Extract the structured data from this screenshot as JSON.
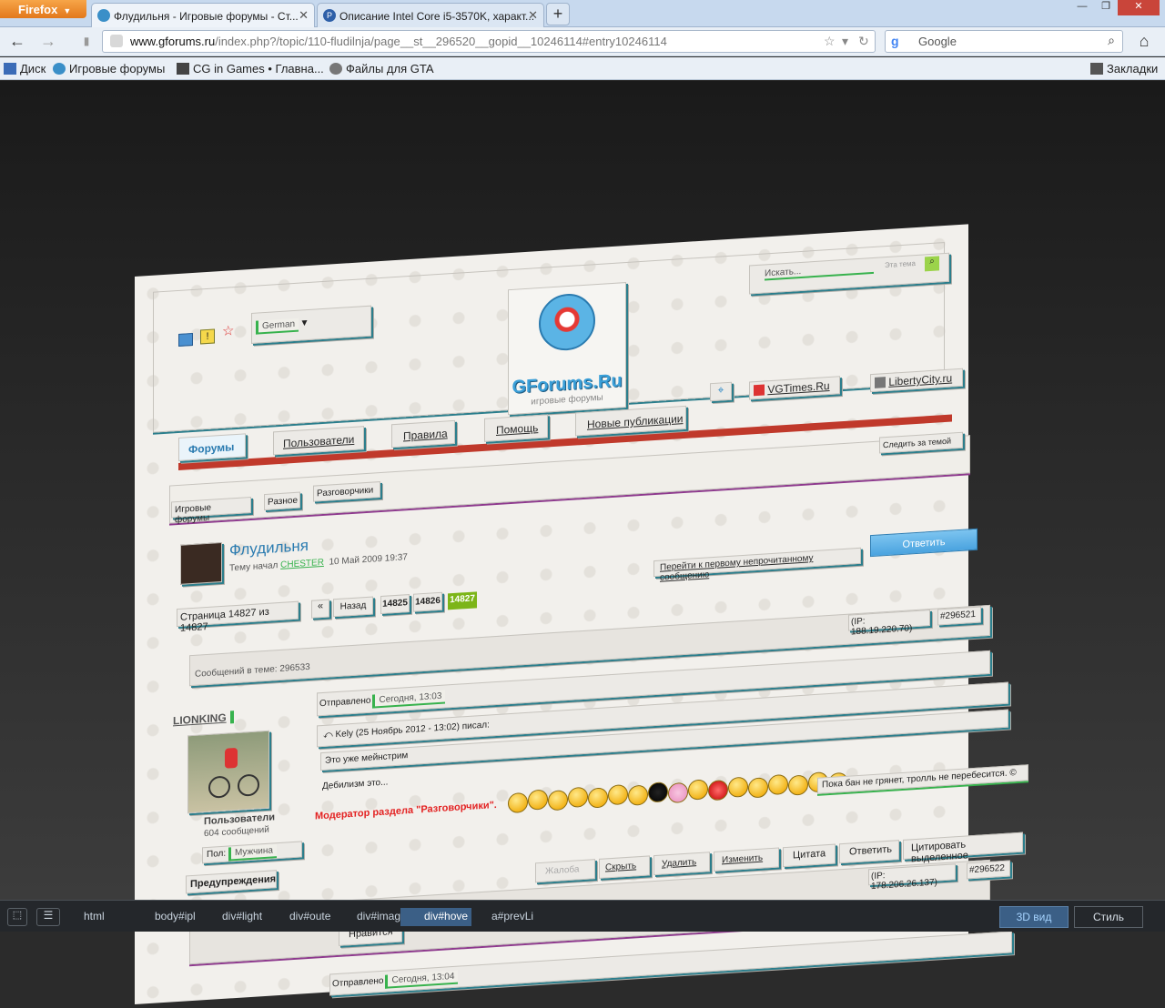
{
  "browser": {
    "menu_button": "Firefox",
    "tabs": [
      {
        "title": "Флудильня - Игровые форумы - Ст...",
        "icon": "forum-favicon"
      },
      {
        "title": "Описание Intel Core i5-3570K, характ...",
        "icon": "p-favicon"
      }
    ],
    "new_tab": "+",
    "url_domain": "www.gforums.ru",
    "url_rest": "/index.php?/topic/110-fludilnja/page__st__296520__gopid__10246114#entry10246114",
    "search_placeholder": "Google",
    "bookmarks": [
      "Диск",
      "Игровые форумы",
      "CG in Games • Главна...",
      "Файлы для GTA"
    ],
    "bookmarks_menu": "Закладки"
  },
  "forum": {
    "language": "German",
    "logo_text": "GForums.Ru",
    "logo_sub": "игровые форумы",
    "search_placeholder": "Искать...",
    "search_scope": "Эта тема",
    "partner_links": [
      "VGTimes.Ru",
      "LibertyCity.ru"
    ],
    "nav": [
      "Форумы",
      "Пользователи",
      "Правила",
      "Помощь",
      "Новые публикации"
    ],
    "breadcrumbs": [
      "Игровые форумы",
      "Разное",
      "Разговорчики"
    ],
    "follow_topic": "Следить за темой",
    "topic_title": "Флудильня",
    "topic_started_prefix": "Тему начал",
    "topic_author": "CHESTER",
    "topic_date": "10 Май 2009 19:37",
    "reply_button": "Ответить",
    "unread_link": "Перейти к первому непрочитанному сообщению",
    "pagination": {
      "page_text": "Страница 14827 из 14827",
      "first": "«",
      "prev": "Назад",
      "pages": [
        "14825",
        "14826",
        "14827"
      ]
    },
    "post_count_text": "Сообщений в теме: 296533",
    "post1": {
      "ip": "(IP: 188.19.220.70)",
      "id": "#296521",
      "author": "LIONKING",
      "sent_label": "Отправлено",
      "sent_time": "Сегодня, 13:03",
      "quote_header": "Kely (25 Ноябрь 2012 - 13:02) писал:",
      "quote_text": "Это уже мейнстрим",
      "body_text": "Дебилизм это...",
      "group": "Пользователи",
      "posts": "604 сообщений",
      "gender_label": "Пол:",
      "gender_value": "Мужчина",
      "warnings": "Предупреждения",
      "moderator_note": "Модератор раздела \"Разговорчики\".",
      "signature": "Пока бан не грянет, тролль не перебесится. ©",
      "actions": [
        "Жалоба",
        "Скрыть",
        "Удалить",
        "Изменить",
        "Цитата",
        "Ответить",
        "Цитировать выделенное"
      ],
      "like_button": "Нравится"
    },
    "post2": {
      "ip": "(IP: 178.206.26.137)",
      "id": "#296522",
      "sent_label": "Отправлено",
      "sent_time": "Сегодня, 13:04"
    }
  },
  "devtools": {
    "breadcrumbs": [
      "html",
      "body#ipl",
      "div#light",
      "div#oute",
      "div#imag",
      "div#hove",
      "a#prevLi"
    ],
    "view_3d": "3D вид",
    "style": "Стиль"
  },
  "colors": {
    "accent_green": "#37b24d",
    "accent_teal": "#2b7e8c",
    "reply_blue": "#4aa3df",
    "nav_red": "#c0392b"
  }
}
